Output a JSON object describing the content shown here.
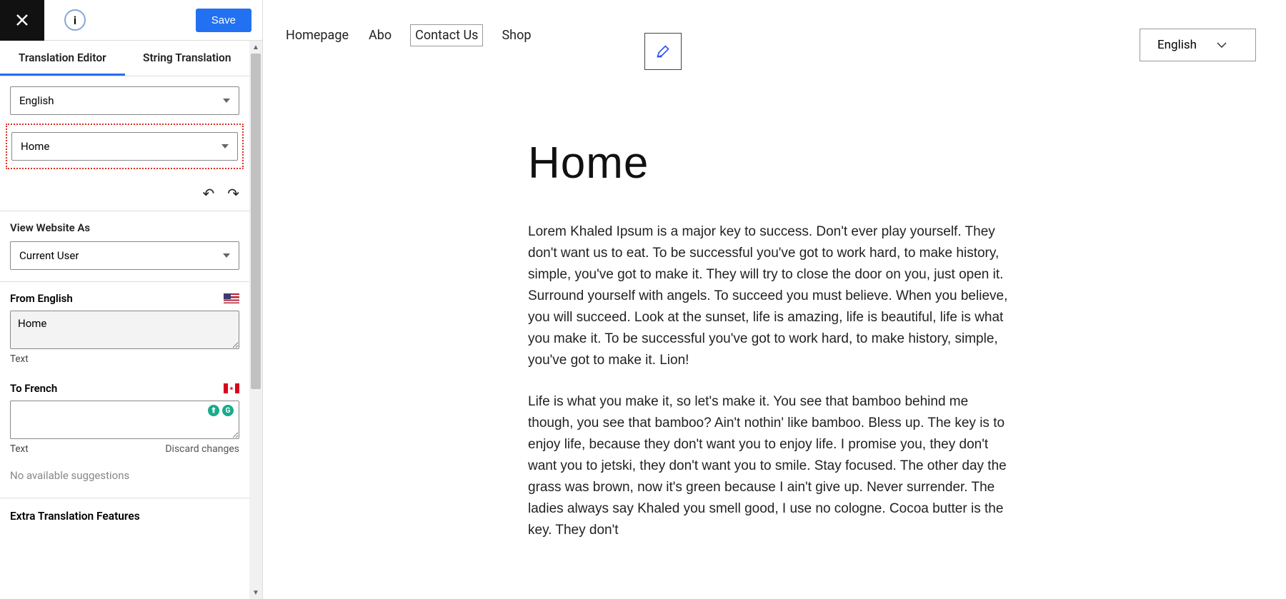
{
  "sidebar": {
    "save_label": "Save",
    "tabs": {
      "editor": "Translation Editor",
      "strings": "String Translation"
    },
    "lang_select": "English",
    "string_select": "Home",
    "view_as_label": "View Website As",
    "view_as_value": "Current User",
    "from_label": "From English",
    "from_value": "Home",
    "from_sublabel": "Text",
    "to_label": "To French",
    "to_value": "",
    "to_sublabel": "Text",
    "discard_label": "Discard changes",
    "no_suggestions": "No available suggestions",
    "extra_label": "Extra Translation Features"
  },
  "preview": {
    "nav": {
      "home": "Homepage",
      "about": "Abo",
      "contact": "Contact Us",
      "shop": "Shop"
    },
    "lang_switcher": "English",
    "title": "Home",
    "p1": "Lorem Khaled Ipsum is a major key to success. Don't ever play yourself. They don't want us to eat. To be successful you've got to work hard, to make history, simple, you've got to make it. They will try to close the door on you, just open it. Surround yourself with angels. To succeed you must believe. When you believe, you will succeed. Look at the sunset, life is amazing, life is beautiful, life is what you make it. To be successful you've got to work hard, to make history, simple, you've got to make it. Lion!",
    "p2": "Life is what you make it, so let's make it. You see that bamboo behind me though, you see that bamboo? Ain't nothin' like bamboo. Bless up. The key is to enjoy life, because they don't want you to enjoy life. I promise you, they don't want you to jetski, they don't want you to smile. Stay focused. The other day the grass was brown, now it's green because I ain't give up. Never surrender. The ladies always say Khaled you smell good, I use no cologne. Cocoa butter is the key. They don't"
  }
}
